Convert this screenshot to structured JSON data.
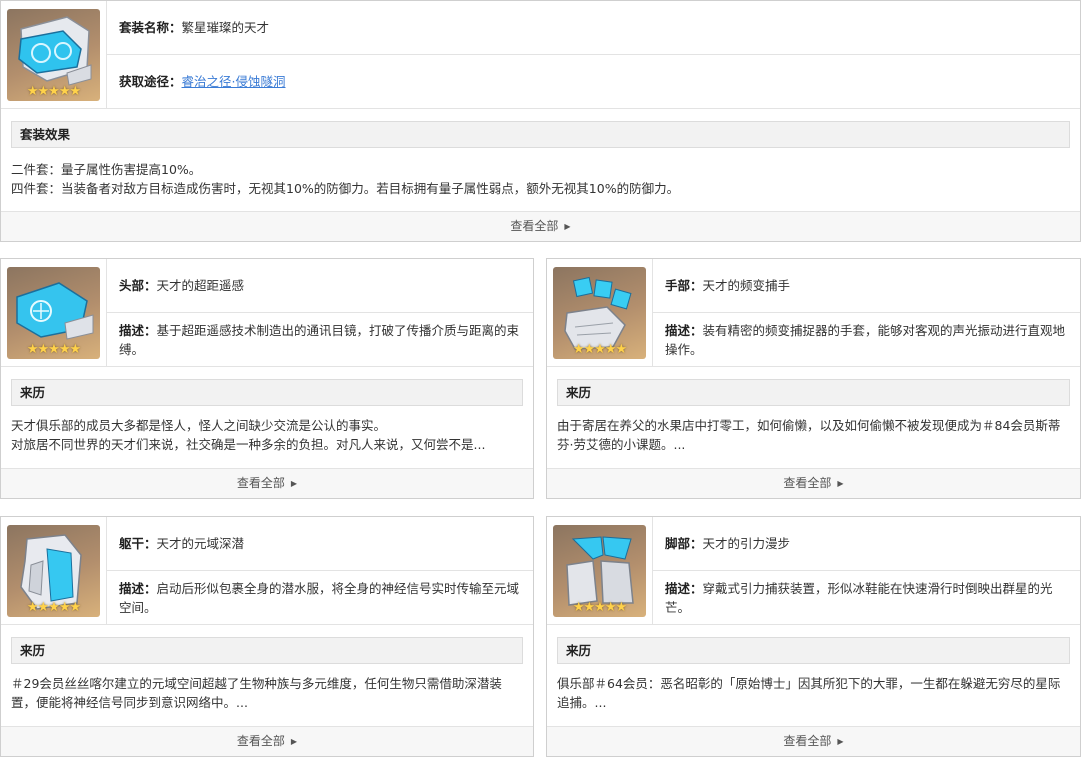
{
  "set": {
    "name_label": "套装名称：",
    "name": "繁星璀璨的天才",
    "source_label": "获取途径：",
    "source": "睿治之径·侵蚀隧洞",
    "effect_title": "套装效果",
    "effect_lines": [
      "二件套：量子属性伤害提高10%。",
      "四件套：当装备者对敌方目标造成伤害时，无视其10%的防御力。若目标拥有量子属性弱点，额外无视其10%的防御力。"
    ],
    "view_all": "查看全部"
  },
  "pieces": [
    {
      "slot_label": "头部：",
      "name": "天才的超距遥感",
      "desc_label": "描述：",
      "desc": "基于超距遥感技术制造出的通讯目镜，打破了传播介质与距离的束缚。",
      "history_title": "来历",
      "history": "天才俱乐部的成员大多都是怪人，怪人之间缺少交流是公认的事实。\n对旅居不同世界的天才们来说，社交确是一种多余的负担。对凡人来说，又何尝不是...",
      "view_all": "查看全部",
      "icon": "goggles-icon"
    },
    {
      "slot_label": "手部：",
      "name": "天才的频变捕手",
      "desc_label": "描述：",
      "desc": "装有精密的频变捕捉器的手套，能够对客观的声光振动进行直观地操作。",
      "history_title": "来历",
      "history": "由于寄居在养父的水果店中打零工，如何偷懒，以及如何偷懒不被发现便成为＃84会员斯蒂芬·劳艾德的小课题。...",
      "view_all": "查看全部",
      "icon": "glove-icon"
    },
    {
      "slot_label": "躯干：",
      "name": "天才的元域深潜",
      "desc_label": "描述：",
      "desc": "启动后形似包裹全身的潜水服，将全身的神经信号实时传输至元域空间。",
      "history_title": "来历",
      "history": "＃29会员丝丝喀尔建立的元域空间超越了生物种族与多元维度，任何生物只需借助深潜装置，便能将神经信号同步到意识网络中。...",
      "view_all": "查看全部",
      "icon": "suit-icon"
    },
    {
      "slot_label": "脚部：",
      "name": "天才的引力漫步",
      "desc_label": "描述：",
      "desc": "穿戴式引力捕获装置，形似冰鞋能在快速滑行时倒映出群星的光芒。",
      "history_title": "来历",
      "history": "俱乐部＃64会员：恶名昭彰的「原始博士」因其所犯下的大罪，一生都在躲避无穷尽的星际追捕。...",
      "view_all": "查看全部",
      "icon": "boots-icon"
    }
  ],
  "stars": "★★★★★",
  "colors": {
    "link": "#3a7bd5",
    "icon_bg": "#b38f6d",
    "glow": "#34c6f0"
  }
}
